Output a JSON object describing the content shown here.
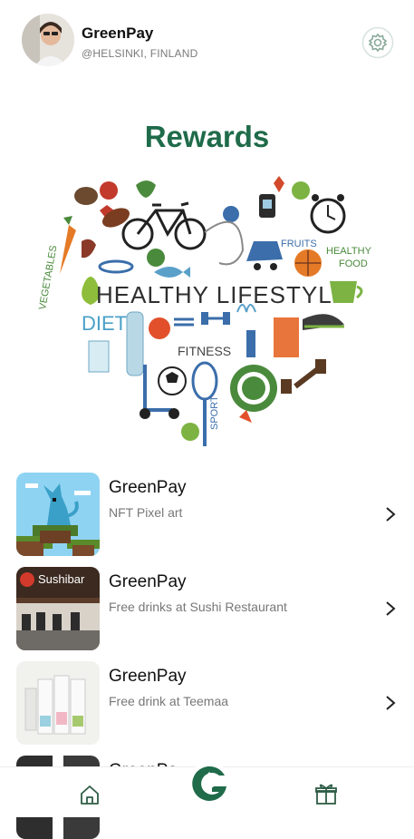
{
  "header": {
    "user_name": "GreenPay",
    "user_location": "@HELSINKI, FINLAND"
  },
  "page": {
    "title": "Rewards"
  },
  "hero": {
    "headline": "HEALTHY LIFESTYLE",
    "words": [
      "DIET",
      "FITNESS",
      "SPORT",
      "FRUITS",
      "HEALTHY",
      "FOOD",
      "VEGETABLES"
    ]
  },
  "rewards": [
    {
      "title": "GreenPay",
      "subtitle": "NFT Pixel art",
      "thumb": "nft-pixel-art"
    },
    {
      "title": "GreenPay",
      "subtitle": "Free drinks at Sushi Restaurant",
      "thumb": "sushibar",
      "thumb_text": "Sushibar"
    },
    {
      "title": "GreenPay",
      "subtitle": "Free drink at Teemaa",
      "thumb": "teemaa"
    },
    {
      "title": "GreenPa",
      "subtitle": "",
      "thumb": "partial"
    }
  ],
  "colors": {
    "accent": "#1f6b4a",
    "subtitle": "#777777"
  },
  "nav": {
    "items": [
      "home-icon",
      "greenpay-logo",
      "gift-icon"
    ]
  }
}
